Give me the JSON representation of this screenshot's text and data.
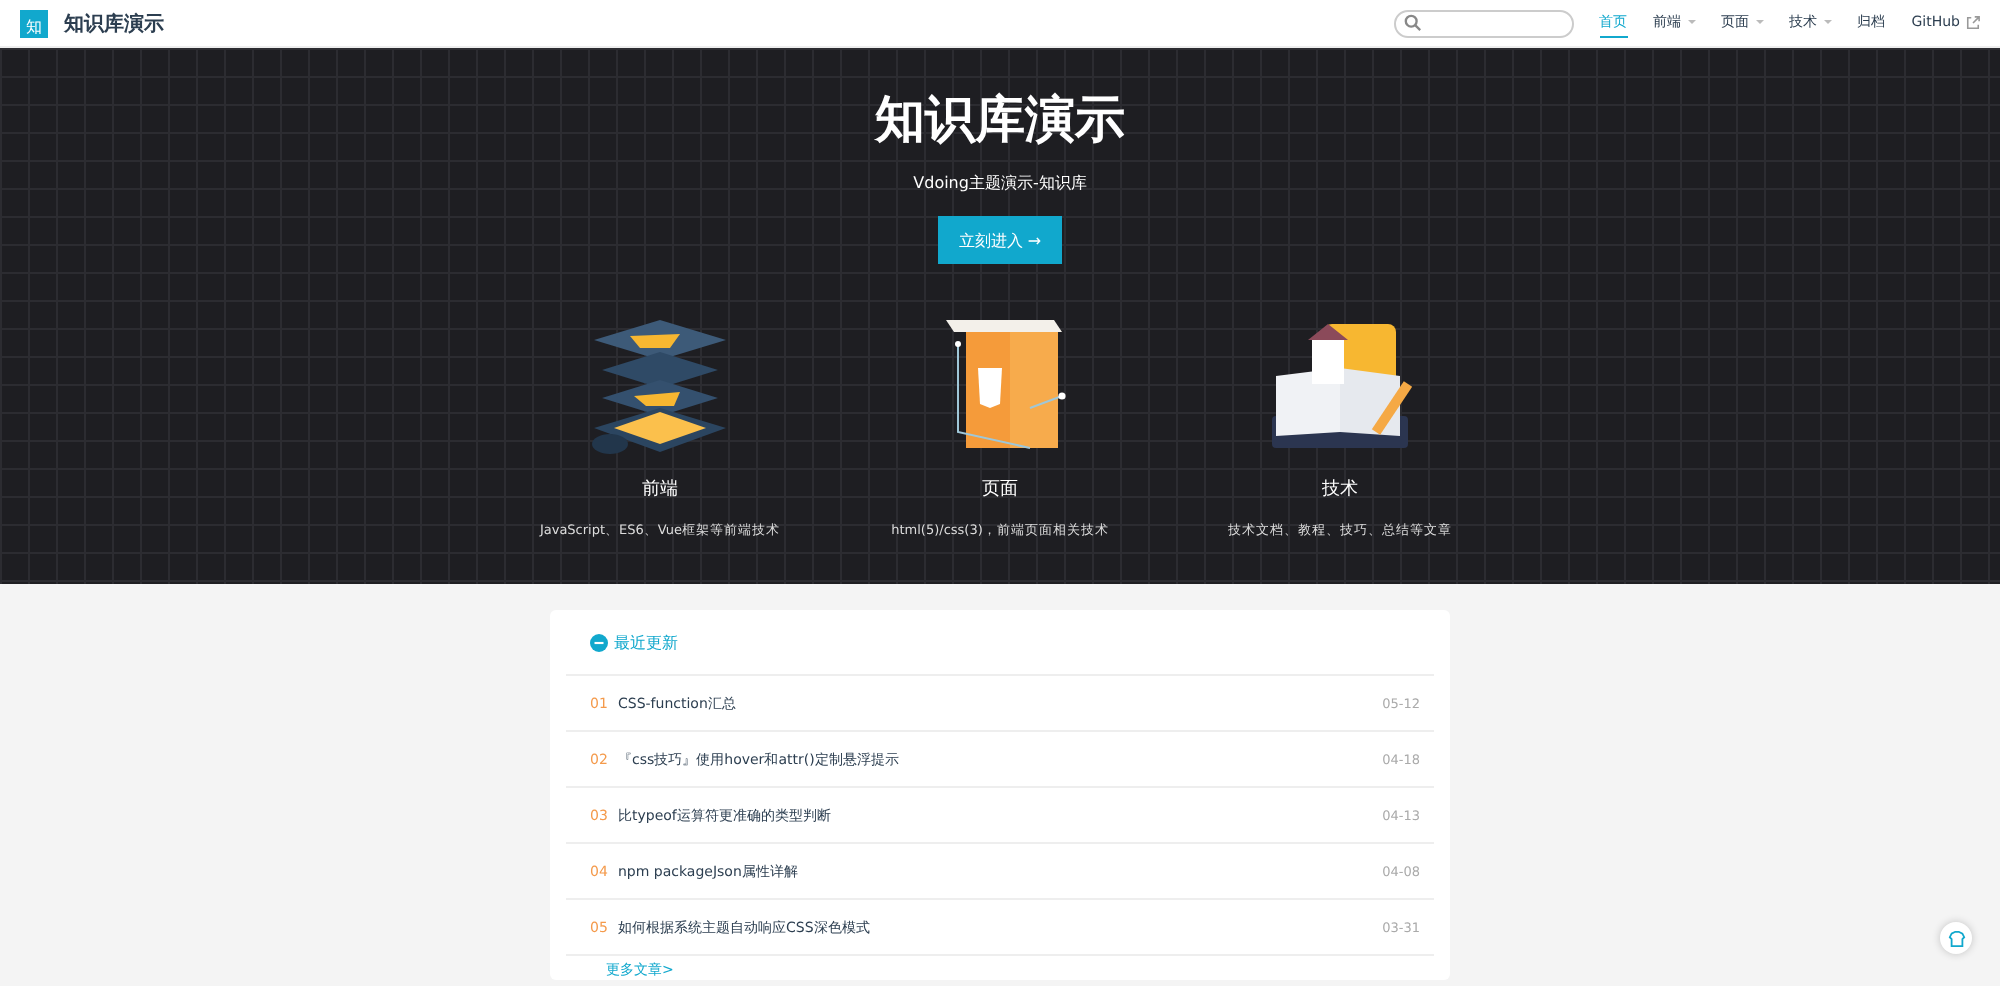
{
  "site": {
    "logo_char": "知",
    "title": "知识库演示"
  },
  "nav": [
    {
      "label": "首页",
      "selected": true,
      "kind": "link"
    },
    {
      "label": "前端",
      "selected": false,
      "kind": "dropdown"
    },
    {
      "label": "页面",
      "selected": false,
      "kind": "dropdown"
    },
    {
      "label": "技术",
      "selected": false,
      "kind": "dropdown"
    },
    {
      "label": "归档",
      "selected": false,
      "kind": "link"
    },
    {
      "label": "GitHub",
      "selected": false,
      "kind": "external"
    }
  ],
  "hero": {
    "title": "知识库演示",
    "subtitle": "Vdoing主题演示-知识库",
    "button": "立刻进入 →"
  },
  "features": [
    {
      "kind": "layers",
      "title": "前端",
      "desc": "JavaScript、ES6、Vue框架等前端技术"
    },
    {
      "kind": "page",
      "title": "页面",
      "desc": "html(5)/css(3)，前端页面相关技术"
    },
    {
      "kind": "book",
      "title": "技术",
      "desc": "技术文档、教程、技巧、总结等文章"
    }
  ],
  "updates": {
    "title": "最近更新",
    "more": "更多文章>",
    "items": [
      {
        "index": "01",
        "title": "CSS-function汇总",
        "date": "05-12"
      },
      {
        "index": "02",
        "title": "『css技巧』使用hover和attr()定制悬浮提示",
        "date": "04-18"
      },
      {
        "index": "03",
        "title": "比typeof运算符更准确的类型判断",
        "date": "04-13"
      },
      {
        "index": "04",
        "title": "npm packageJson属性详解",
        "date": "04-08"
      },
      {
        "index": "05",
        "title": "如何根据系统主题自动响应CSS深色模式",
        "date": "03-31"
      }
    ]
  }
}
